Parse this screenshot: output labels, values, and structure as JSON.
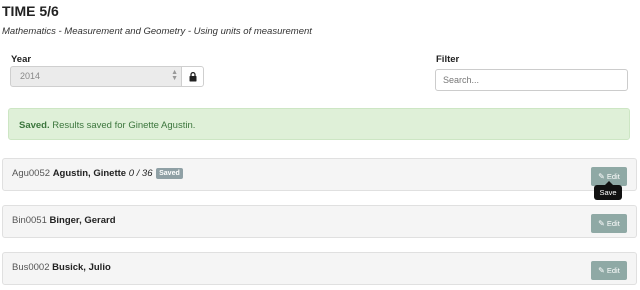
{
  "header": {
    "title": "TIME 5/6",
    "subtitle": "Mathematics - Measurement and Geometry - Using units of measurement"
  },
  "year": {
    "label": "Year",
    "value": "2014",
    "lock_icon": "lock-icon"
  },
  "filter": {
    "label": "Filter",
    "placeholder": "Search..."
  },
  "alert": {
    "strong": "Saved.",
    "message": "Results saved for Ginette Agustin."
  },
  "students": [
    {
      "code": "Agu0052",
      "name": "Agustin, Ginette",
      "score": "0 / 36",
      "badge": "Saved",
      "edit_label": "Edit"
    },
    {
      "code": "Bin0051",
      "name": "Binger, Gerard",
      "edit_label": "Edit"
    },
    {
      "code": "Bus0002",
      "name": "Busick, Julio",
      "edit_label": "Edit"
    }
  ],
  "tooltip": {
    "text": "Save"
  },
  "colors": {
    "alert_bg": "#dff0d8",
    "alert_text": "#3c763d",
    "edit_button": "#8fa9a5",
    "badge": "#8fa0a5"
  }
}
